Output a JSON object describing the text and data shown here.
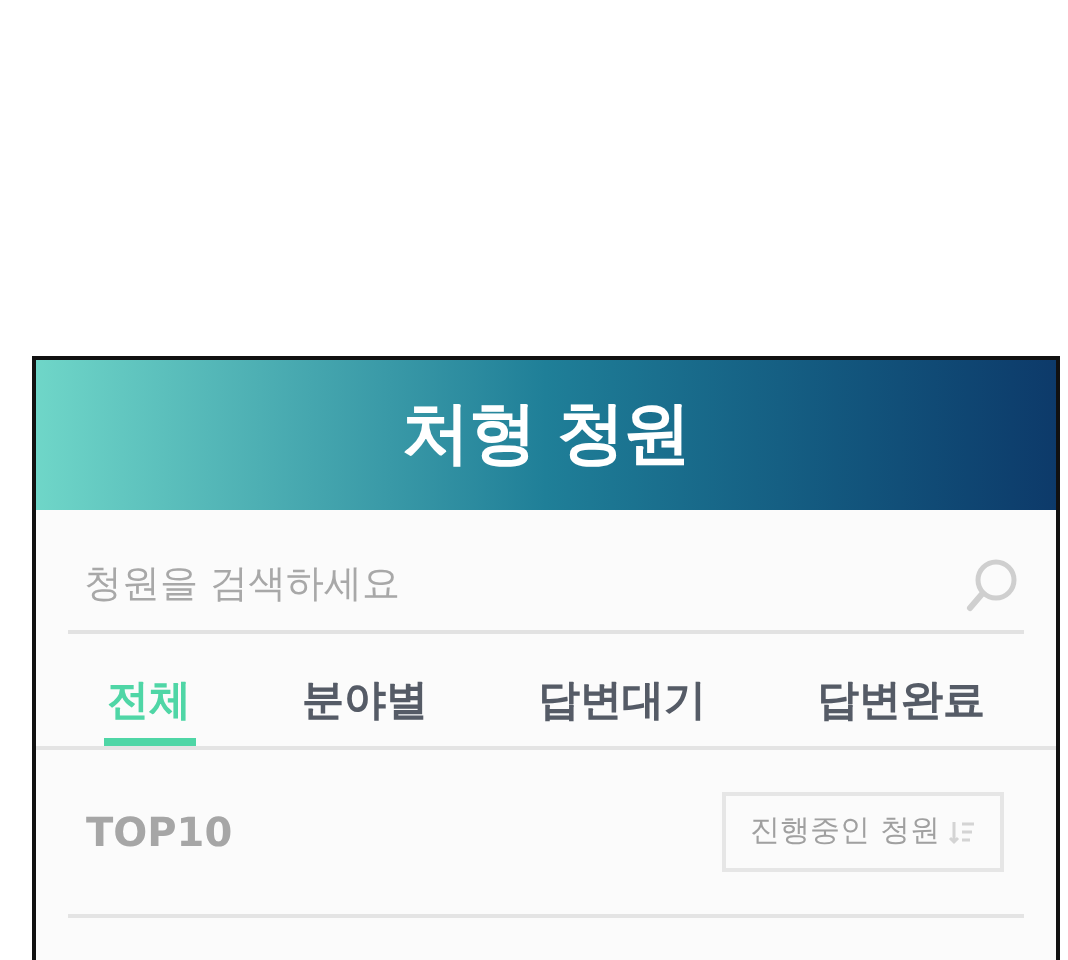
{
  "header": {
    "title": "처형 청원"
  },
  "search": {
    "placeholder": "청원을 검색하세요"
  },
  "tabs": [
    {
      "label": "전체",
      "selected": true
    },
    {
      "label": "분야별",
      "selected": false
    },
    {
      "label": "답변대기",
      "selected": false
    },
    {
      "label": "답변완료",
      "selected": false
    }
  ],
  "list_header": {
    "title": "TOP10",
    "sort_button": "진행중인 청원"
  }
}
